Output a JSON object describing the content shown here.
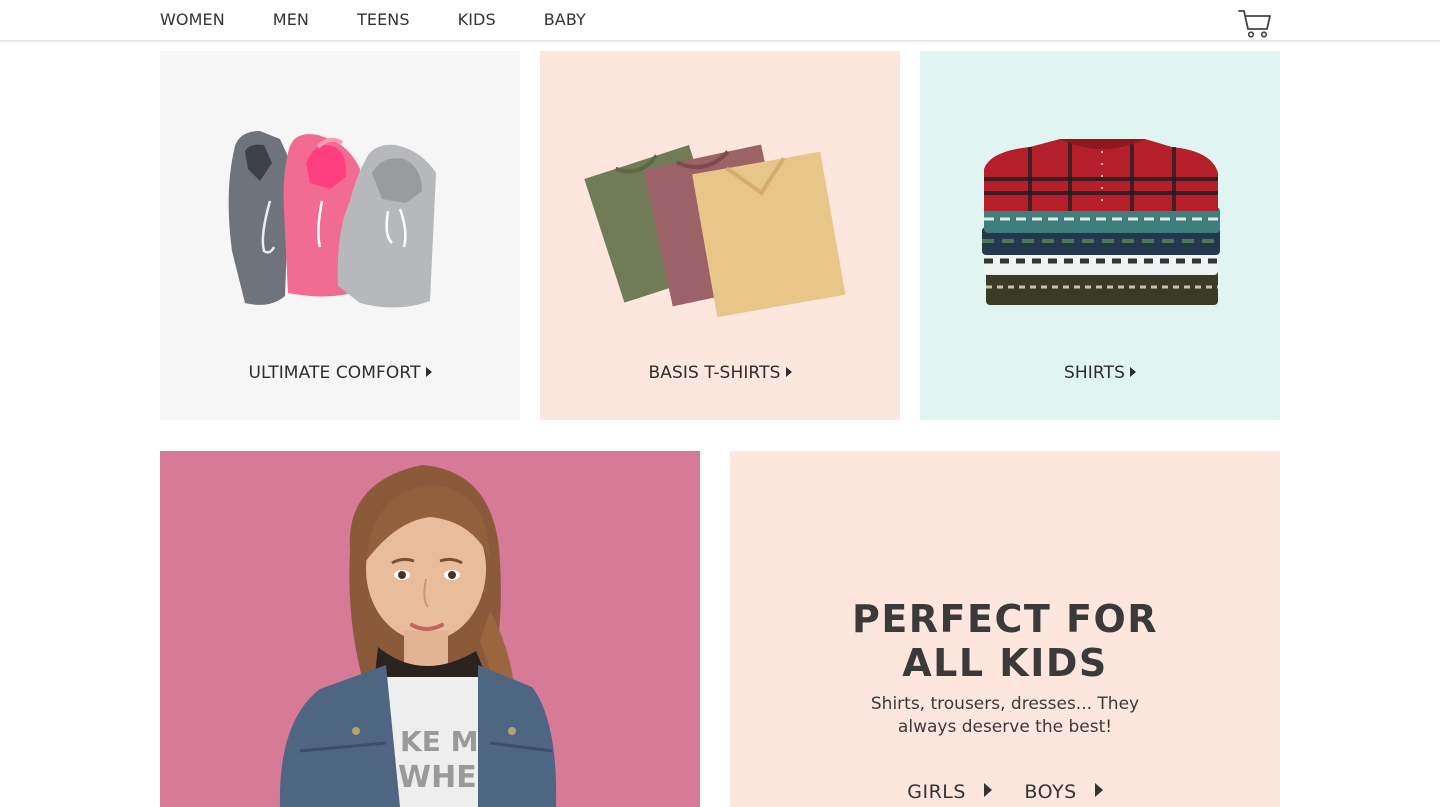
{
  "nav": {
    "items": [
      {
        "label": "WOMEN"
      },
      {
        "label": "MEN"
      },
      {
        "label": "TEENS"
      },
      {
        "label": "KIDS"
      },
      {
        "label": "BABY"
      }
    ],
    "cart_icon": "shopping-cart-icon"
  },
  "categories": [
    {
      "label": "ULTIMATE COMFORT",
      "bg": "#f6f6f6",
      "image": "hoodies"
    },
    {
      "label": "BASIS T-SHIRTS",
      "bg": "#fde6dd",
      "image": "t-shirts"
    },
    {
      "label": "SHIRTS",
      "bg": "#e0f4f1",
      "image": "flannel-shirts"
    }
  ],
  "hero": {
    "image": "girl-in-denim-jacket",
    "bg": "#d77a97"
  },
  "promo": {
    "title_line1": "PERFECT FOR",
    "title_line2": "ALL KIDS",
    "text_line1": "Shirts, trousers, dresses... They",
    "text_line2": "always deserve the best!",
    "links": [
      {
        "label": "GIRLS"
      },
      {
        "label": "BOYS"
      }
    ],
    "bg": "#fde6dd"
  }
}
